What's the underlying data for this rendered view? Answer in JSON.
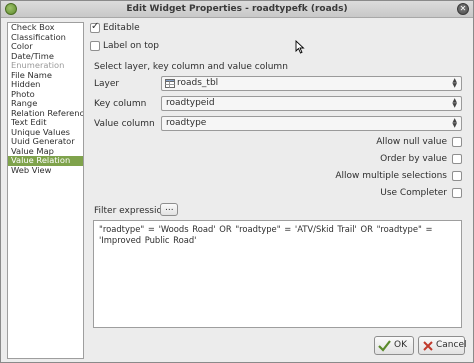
{
  "window": {
    "title": "Edit Widget Properties - roadtypefk (roads)"
  },
  "widget_types": [
    {
      "label": "Check Box",
      "state": "normal"
    },
    {
      "label": "Classification",
      "state": "normal"
    },
    {
      "label": "Color",
      "state": "normal"
    },
    {
      "label": "Date/Time",
      "state": "normal"
    },
    {
      "label": "Enumeration",
      "state": "disabled"
    },
    {
      "label": "File Name",
      "state": "normal"
    },
    {
      "label": "Hidden",
      "state": "normal"
    },
    {
      "label": "Photo",
      "state": "normal"
    },
    {
      "label": "Range",
      "state": "normal"
    },
    {
      "label": "Relation Reference",
      "state": "normal"
    },
    {
      "label": "Text Edit",
      "state": "normal"
    },
    {
      "label": "Unique Values",
      "state": "normal"
    },
    {
      "label": "Uuid Generator",
      "state": "normal"
    },
    {
      "label": "Value Map",
      "state": "normal"
    },
    {
      "label": "Value Relation",
      "state": "selected"
    },
    {
      "label": "Web View",
      "state": "normal"
    }
  ],
  "editable": {
    "label": "Editable",
    "checked": true
  },
  "label_on_top": {
    "label": "Label on top",
    "checked": false
  },
  "section_heading": "Select layer, key column and value column",
  "layer": {
    "label": "Layer",
    "value": "roads_tbl"
  },
  "key_column": {
    "label": "Key column",
    "value": "roadtypeid"
  },
  "value_column": {
    "label": "Value column",
    "value": "roadtype"
  },
  "options": {
    "allow_null": {
      "label": "Allow null value",
      "checked": false
    },
    "order_by_value": {
      "label": "Order by value",
      "checked": false
    },
    "allow_multiple": {
      "label": "Allow multiple selections",
      "checked": false
    },
    "use_completer": {
      "label": "Use Completer",
      "checked": false
    }
  },
  "filter": {
    "label": "Filter expression",
    "button_label": "...",
    "expression": "\"roadtype\" = 'Woods Road' OR \"roadtype\" = 'ATV/Skid Trail' OR \"roadtype\" = 'Improved Public Road'"
  },
  "buttons": {
    "ok": "OK",
    "cancel": "Cancel"
  },
  "colors": {
    "selection": "#7fa34c",
    "ok_icon": "#5a8a2a",
    "cancel_icon": "#c0392b"
  }
}
